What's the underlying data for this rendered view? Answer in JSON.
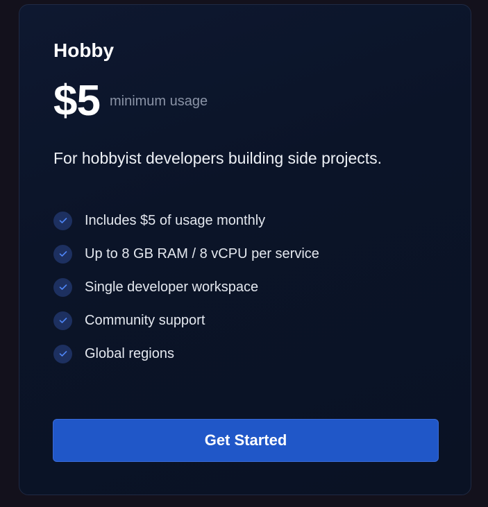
{
  "plan": {
    "name": "Hobby",
    "price": "$5",
    "price_note": "minimum usage",
    "description": "For hobbyist developers building side projects."
  },
  "features": [
    {
      "label": "Includes $5 of usage monthly",
      "icon": "check-icon"
    },
    {
      "label": "Up to 8 GB RAM / 8 vCPU per service",
      "icon": "check-icon"
    },
    {
      "label": "Single developer workspace",
      "icon": "check-icon"
    },
    {
      "label": "Community support",
      "icon": "check-icon"
    },
    {
      "label": "Global regions",
      "icon": "check-icon"
    }
  ],
  "cta": {
    "label": "Get Started"
  },
  "colors": {
    "background": "#13111c",
    "card": "#0b1428",
    "accent": "#2057c8",
    "check_bg": "#1d3060",
    "check_mark": "#4f86f7"
  }
}
